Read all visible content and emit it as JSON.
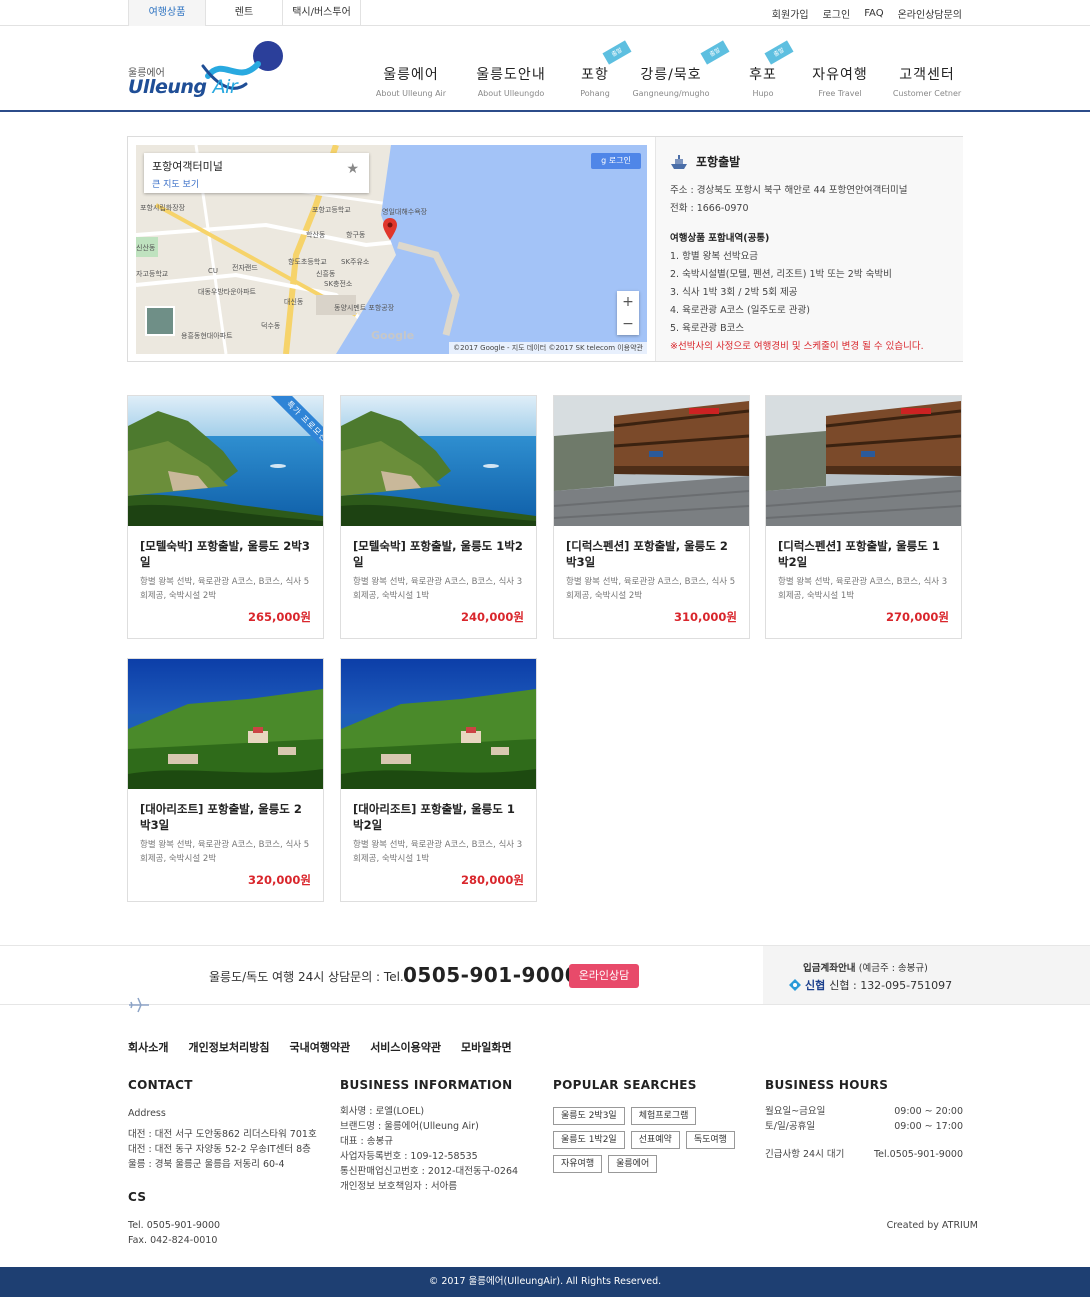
{
  "topbar": {
    "tabs": [
      "여행상품",
      "렌트",
      "택시/버스투어"
    ],
    "links": [
      "회원가입",
      "로그인",
      "FAQ",
      "온라인상담문의"
    ]
  },
  "logo": {
    "ko": "울릉에어",
    "en_main": "Ulleung",
    "en_sub": "Air"
  },
  "nav": [
    {
      "ko": "울릉에어",
      "en": "About Ulleung Air"
    },
    {
      "ko": "울릉도안내",
      "en": "About Ulleungdo"
    },
    {
      "ko": "포항",
      "en": "Pohang",
      "badge": "출발"
    },
    {
      "ko": "강릉/묵호",
      "en": "Gangneung/mugho",
      "badge": "출발"
    },
    {
      "ko": "후포",
      "en": "Hupo",
      "badge": "출발"
    },
    {
      "ko": "자유여행",
      "en": "Free Travel"
    },
    {
      "ko": "고객센터",
      "en": "Customer Cetner"
    }
  ],
  "map": {
    "place": "포항여객터미널",
    "link": "큰 지도 보기",
    "login": "로그인",
    "zoom_in": "+",
    "zoom_out": "−",
    "copyright": "©2017 Google - 지도 데이터 ©2017 SK telecom   이용약관",
    "google": "Google",
    "labels": [
      "포항시립화장장",
      "포항고등학교",
      "학산동",
      "항구동",
      "전자랜드",
      "항도초등학교",
      "SK주유소",
      "SK충전소",
      "대동우방타운아파트",
      "동양시멘트 포항공장",
      "대신동",
      "덕수동",
      "용흥동현대아파트",
      "영일대해수욕장",
      "자고등학교",
      "신흥동",
      "CU",
      "신산동"
    ]
  },
  "departure": {
    "title": "포항출발",
    "address": "주소 : 경상북도 포항시 북구 해안로 44 포항연안여객터미널",
    "phone": "전화 : 1666-0970",
    "includes_title": "여행상품 포함내역(공통)",
    "includes": [
      "1. 항별 왕복 선박요금",
      "2. 숙박시설별(모텔, 펜션, 리조트) 1박 또는 2박 숙박비",
      "3. 식사 1박 3회 / 2박 5회 제공",
      "4. 육로관광 A코스 (일주도로 관광)",
      "5. 육로관광 B코스"
    ],
    "warning": "※선박사의 사정으로 여행경비 및 스케줄이 변경 될 수 있습니다."
  },
  "products": [
    {
      "title": "[모텔숙박] 포항출발, 울릉도 2박3일",
      "desc": "항별 왕복 선박, 육로관광 A코스, B코스, 식사 5회제공, 숙박시설 2박",
      "price": "265,000원",
      "ribbon": "특가 프로모션",
      "scene": "coast"
    },
    {
      "title": "[모텔숙박] 포항출발, 울릉도 1박2일",
      "desc": "항별 왕복 선박, 육로관광 A코스, B코스, 식사 3회제공, 숙박시설 1박",
      "price": "240,000원",
      "scene": "coast"
    },
    {
      "title": "[디럭스펜션] 포항출발, 울릉도 2박3일",
      "desc": "항별 왕복 선박, 육로관광 A코스, B코스, 식사 5회제공, 숙박시설 2박",
      "price": "310,000원",
      "scene": "pension"
    },
    {
      "title": "[디럭스펜션] 포항출발, 울릉도 1박2일",
      "desc": "항별 왕복 선박, 육로관광 A코스, B코스, 식사 3회제공, 숙박시설 1박",
      "price": "270,000원",
      "scene": "pension"
    },
    {
      "title": "[대아리조트] 포항출발, 울릉도 2박3일",
      "desc": "항별 왕복 선박, 육로관광 A코스, B코스, 식사 5회제공, 숙박시설 2박",
      "price": "320,000원",
      "scene": "resort"
    },
    {
      "title": "[대아리조트] 포항출발, 울릉도 1박2일",
      "desc": "항별 왕복 선박, 육로관광 A코스, B코스, 식사 3회제공, 숙박시설 1박",
      "price": "280,000원",
      "scene": "resort"
    }
  ],
  "contact_strip": {
    "label": "울릉도/독도 여행 24시 상담문의 : Tel.",
    "tel": "0505-901-9000",
    "button": "온라인상담",
    "bank_title": "입금계좌안내",
    "bank_holder": "(예금주 : 송봉규)",
    "bank_name": "신협",
    "bank_account": "신협 : 132-095-751097"
  },
  "footer_links": [
    "회사소개",
    "개인정보처리방침",
    "국내여행약관",
    "서비스이용약관",
    "모바일화면"
  ],
  "contact": {
    "heading": "CONTACT",
    "address_label": "Address",
    "addresses": [
      "대전 : 대전 서구 도안동862 리더스타워 701호",
      "대전 : 대전 동구 자양동 52-2 우송IT센터 8층",
      "울릉 : 경북 울릉군 울릉읍 저동리 60-4"
    ],
    "cs_heading": "CS",
    "tel": "Tel. 0505-901-9000",
    "fax": "Fax. 042-824-0010"
  },
  "business": {
    "heading": "BUSINESS INFORMATION",
    "lines": [
      "회사명 : 로엘(LOEL)",
      "브랜드명 : 울릉에어(Ulleung Air)",
      "대표 : 송봉규",
      "사업자등록번호 : 109-12-58535",
      "통신판매업신고번호 : 2012-대전동구-0264",
      "개인정보 보호책임자 : 서아름"
    ]
  },
  "popular": {
    "heading": "POPULAR SEARCHES",
    "tags": [
      "울릉도 2박3일",
      "체험프로그램",
      "울릉도 1박2일",
      "선표예약",
      "독도여행",
      "자유여행",
      "울릉에어"
    ]
  },
  "hours": {
    "heading": "BUSINESS HOURS",
    "rows": [
      {
        "day": "월요일~금요일",
        "time": "09:00 ~ 20:00"
      },
      {
        "day": "토/일/공휴일",
        "time": "09:00 ~ 17:00"
      },
      {
        "day": "긴급사항 24시 대기",
        "time": "Tel.0505-901-9000"
      }
    ],
    "credit": "Created by ATRIUM"
  },
  "copyright": "© 2017 울릉에어(UlleungAir). All Rights Reserved.",
  "colors": {
    "accent": "#2f74c2",
    "navy": "#1e3f72",
    "price": "#d9262c",
    "consult": "#e84a6a"
  }
}
